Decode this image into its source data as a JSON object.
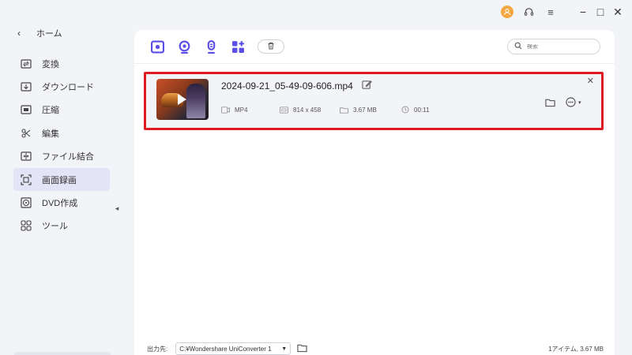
{
  "sidebar": {
    "home_label": "ホーム",
    "items": [
      {
        "label": "変換",
        "icon": "convert-icon"
      },
      {
        "label": "ダウンロード",
        "icon": "download-icon"
      },
      {
        "label": "圧縮",
        "icon": "compress-icon"
      },
      {
        "label": "編集",
        "icon": "scissors-icon"
      },
      {
        "label": "ファイル結合",
        "icon": "merge-icon"
      },
      {
        "label": "画面録画",
        "icon": "screen-record-icon",
        "active": true
      },
      {
        "label": "DVD作成",
        "icon": "dvd-icon"
      },
      {
        "label": "ツール",
        "icon": "tools-grid-icon"
      }
    ]
  },
  "toolbar": {
    "tools": [
      "screen-recorder-icon",
      "webcam-icon",
      "microphone-icon",
      "add-apps-icon",
      "delete-icon"
    ]
  },
  "search": {
    "placeholder": "検索"
  },
  "file": {
    "name": "2024-09-21_05-49-09-606.mp4",
    "format": "MP4",
    "resolution": "814 x 458",
    "size": "3.67 MB",
    "duration": "00:11"
  },
  "footer": {
    "output_label": "出力先:",
    "output_path": "C:¥Wondershare UniConverter 1",
    "summary": "1アイテム, 3.67 MB"
  },
  "colors": {
    "accent": "#5b4ee6",
    "highlight": "#e01a22",
    "active_bg": "#e5e4f7",
    "avatar": "#f4a640"
  }
}
